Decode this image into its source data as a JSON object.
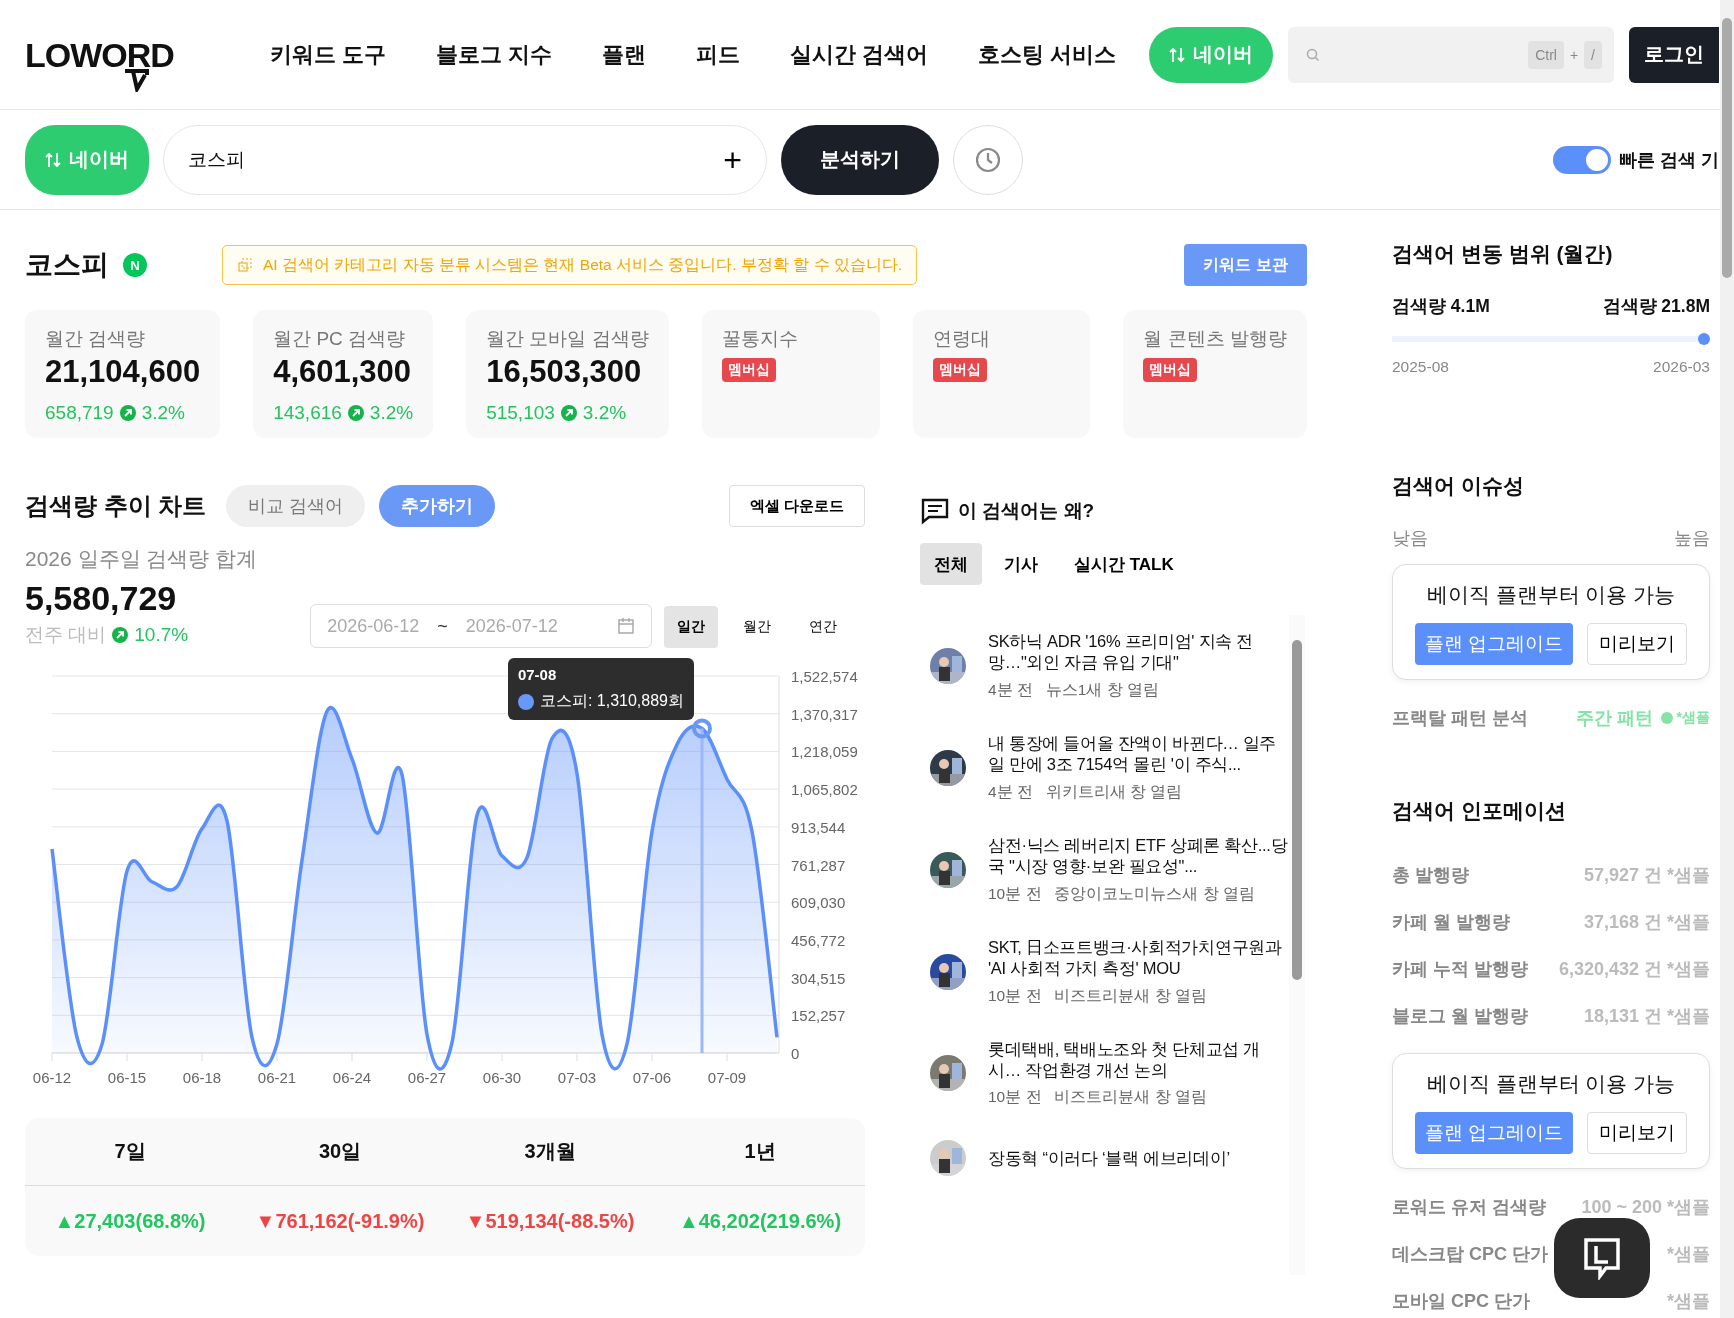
{
  "header": {
    "logo": "LOWORD",
    "nav": [
      "키워드 도구",
      "블로그 지수",
      "플랜",
      "피드",
      "실시간 검색어",
      "호스팅 서비스"
    ],
    "engine_button": "네이버",
    "search": {
      "shortcut_keys": [
        "Ctrl",
        "+",
        "/"
      ]
    },
    "login": "로그인"
  },
  "search_bar": {
    "engine": "네이버",
    "query": "코스피",
    "add": "+",
    "analyze": "분석하기",
    "quick_search": {
      "label": "빠른 검색 기",
      "on": true
    }
  },
  "keyword": {
    "title": "코스피",
    "badge": "N",
    "notice": "AI 검색어 카테고리 자동 분류 시스템은 현재 Beta 서비스 중입니다. 부정확 할 수 있습니다.",
    "save": "키워드 보관"
  },
  "stats": [
    {
      "kind": "value",
      "label": "월간 검색량",
      "value": "21,104,600",
      "delta": "658,719",
      "pct": "3.2%"
    },
    {
      "kind": "value",
      "label": "월간 PC 검색량",
      "value": "4,601,300",
      "delta": "143,616",
      "pct": "3.2%"
    },
    {
      "kind": "value",
      "label": "월간 모바일 검색량",
      "value": "16,503,300",
      "delta": "515,103",
      "pct": "3.2%"
    },
    {
      "kind": "locked",
      "label": "꿀통지수",
      "badge": "멤버십"
    },
    {
      "kind": "locked",
      "label": "연령대",
      "badge": "멤버십"
    },
    {
      "kind": "locked",
      "label": "월 콘텐츠 발행량",
      "badge": "멤버십"
    }
  ],
  "trend": {
    "title": "검색량 추이 차트",
    "compare": "비교 검색어",
    "add": "추가하기",
    "excel": "엑셀 다운로드",
    "subtitle": "2026 일주일 검색량 합계",
    "total": "5,580,729",
    "vs_label": "전주 대비",
    "vs_pct": "10.7%",
    "date_from": "2026-06-12",
    "date_sep": "~",
    "date_to": "2026-07-12",
    "periods": [
      {
        "label": "일간",
        "selected": true
      },
      {
        "label": "월간",
        "selected": false
      },
      {
        "label": "연간",
        "selected": false
      }
    ],
    "tooltip": {
      "date": "07-08",
      "text": ": 1,310,889회"
    },
    "chart_data": {
      "type": "area",
      "grid": true,
      "categories": [
        "06-12",
        null,
        null,
        "06-15",
        null,
        null,
        "06-18",
        null,
        null,
        "06-21",
        null,
        null,
        "06-24",
        null,
        null,
        "06-27",
        null,
        null,
        "06-30",
        null,
        null,
        "07-03",
        null,
        null,
        "07-06",
        null,
        null,
        "07-09",
        null,
        null
      ],
      "series": [
        {
          "name": "코스피",
          "color": "#5b8ff9",
          "values": [
            824000,
            63000,
            35000,
            735000,
            691000,
            672000,
            906000,
            937000,
            63000,
            37000,
            778000,
            1380000,
            1188000,
            888000,
            1124000,
            75000,
            42000,
            960000,
            796000,
            789000,
            1270000,
            1129000,
            75000,
            37000,
            895000,
            1246000,
            1311000,
            1106000,
            895000,
            63000
          ]
        }
      ],
      "ylim": [
        0,
        1522574
      ],
      "yticks": [
        {
          "value": 0,
          "label": "0"
        },
        {
          "value": 152257,
          "label": "152,257"
        },
        {
          "value": 304515,
          "label": "304,515"
        },
        {
          "value": 456772,
          "label": "456,772"
        },
        {
          "value": 609030,
          "label": "609,030"
        },
        {
          "value": 761287,
          "label": "761,287"
        },
        {
          "value": 913544,
          "label": "913,544"
        },
        {
          "value": 1065802,
          "label": "1,065,802"
        },
        {
          "value": 1218059,
          "label": "1,218,059"
        },
        {
          "value": 1370317,
          "label": "1,370,317"
        },
        {
          "value": 1522574,
          "label": "1,522,574"
        }
      ]
    }
  },
  "period_table": {
    "columns": [
      "7일",
      "30일",
      "3개월",
      "1년"
    ],
    "values": [
      {
        "kind": "up",
        "text": "▲27,403(68.8%)"
      },
      {
        "kind": "down",
        "text": "▼761,162(-91.9%)"
      },
      {
        "kind": "down",
        "text": "▼519,134(-88.5%)"
      },
      {
        "kind": "up",
        "text": "▲46,202(219.6%)"
      }
    ]
  },
  "news": {
    "title": "이 검색어는 왜?",
    "tabs": [
      {
        "label": "전체",
        "selected": true
      },
      {
        "label": "기사",
        "selected": false
      },
      {
        "label": "실시간 TALK",
        "selected": false
      }
    ],
    "items": [
      {
        "headline": "SK하닉 ADR '16% 프리미엄' 지속 전망…\"외인 자금 유입 기대\"",
        "time": "4분 전",
        "source": "뉴스1새 창 열림"
      },
      {
        "headline": "내 통장에 들어올 잔액이 바뀐다… 일주일 만에 3조 7154억 몰린 '이 주식...",
        "time": "4분 전",
        "source": "위키트리새 창 열림"
      },
      {
        "headline": "삼전·닉스 레버리지 ETF 상폐론 확산...당국 \"시장 영향·보완 필요성\"...",
        "time": "10분 전",
        "source": "중앙이코노미뉴스새 창 열림"
      },
      {
        "headline": "SKT, 日소프트뱅크·사회적가치연구원과 'AI 사회적 가치 측정' MOU",
        "time": "10분 전",
        "source": "비즈트리뷴새 창 열림"
      },
      {
        "headline": "롯데택배, 택배노조와 첫 단체교섭 개시… 작업환경 개선 논의",
        "time": "10분 전",
        "source": "비즈트리뷴새 창 열림"
      },
      {
        "headline": "장동혁 “이러다 ‘블랙 에브리데이’"
      }
    ]
  },
  "range": {
    "title": "검색어 변동 범위 (월간)",
    "min_label": "검색량 4.1M",
    "max_label": "검색량 21.8M",
    "level": 1,
    "start": "2025-08",
    "end": "2026-03"
  },
  "issue": {
    "title": "검색어 이슈성",
    "low": "낮음",
    "high": "높음",
    "lock": {
      "text": "베이직 플랜부터 이용 가능",
      "upgrade": "플랜 업그레이드",
      "preview": "미리보기"
    },
    "rows": [
      {
        "label": "프랙탈 패턴 분석",
        "value": "주간 패턴",
        "note": "*샘플"
      }
    ]
  },
  "info": {
    "title": "검색어 인포메이션",
    "rows_before": [
      {
        "label": "총 발행량",
        "value": "57,927 건 *샘플"
      },
      {
        "label": "카페 월 발행량",
        "value": "37,168 건 *샘플"
      },
      {
        "label": "카페 누적 발행량",
        "value": "6,320,432 건 *샘플"
      },
      {
        "label": "블로그 월 발행량",
        "value": "18,131 건 *샘플"
      }
    ],
    "lock": {
      "text": "베이직 플랜부터 이용 가능",
      "upgrade": "플랜 업그레이드",
      "preview": "미리보기"
    },
    "rows_after": [
      {
        "label": "로워드 유저 검색량",
        "value": "100 ~ 200 *샘플"
      },
      {
        "label": "데스크탑 CPC 단가",
        "value": "*샘플"
      },
      {
        "label": "모바일 CPC 단가",
        "value": "*샘플"
      }
    ]
  }
}
